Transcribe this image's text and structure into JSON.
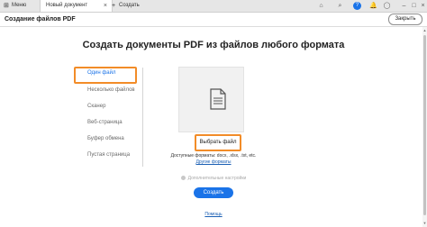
{
  "tabs": {
    "menu_label": "Меню",
    "active_label": "Новый документ",
    "new_label": "Создать"
  },
  "toolbar": {
    "icons": [
      "home-icon",
      "search-icon",
      "help-icon",
      "notifications-icon",
      "account-icon"
    ],
    "help_glyph": "?"
  },
  "header": {
    "title": "Создание файлов PDF",
    "close_label": "Закрыть"
  },
  "main": {
    "heading": "Создать документы PDF из файлов любого формата",
    "nav_items": [
      "Один файл",
      "Несколько файлов",
      "Сканер",
      "Веб-страница",
      "Буфер обмена",
      "Пустая страница"
    ],
    "active_nav_index": 0,
    "choose_file_label": "Выбрать файл",
    "formats_text": "Доступные форматы: docx, .xlsx, .txt, etc.",
    "other_formats_link": "Другие форматы",
    "advanced_settings_label": "Дополнительные настройки",
    "create_button_label": "Создать",
    "help_link": "Помощь"
  },
  "colors": {
    "accent": "#1a73e8",
    "highlight": "#f28c28"
  }
}
